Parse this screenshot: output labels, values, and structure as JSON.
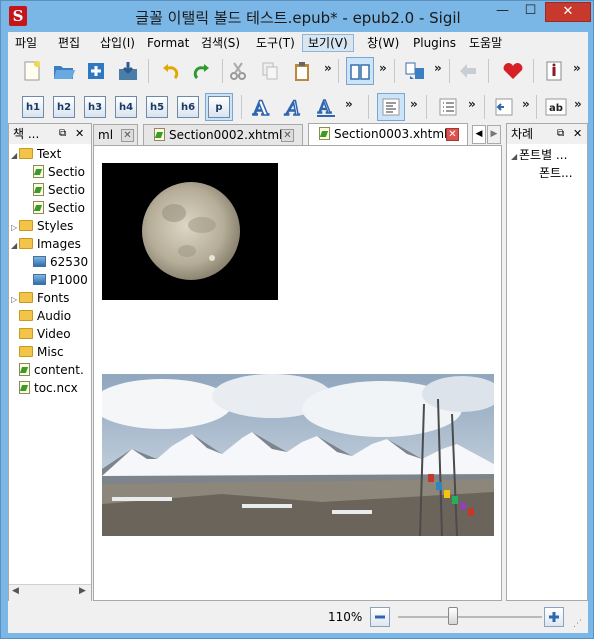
{
  "window": {
    "title": "글꼴 이탤릭 볼드 테스트.epub* - epub2.0 - Sigil",
    "app_icon_letter": "S",
    "minimize": "—",
    "maximize": "☐",
    "close": "✕"
  },
  "menu": [
    {
      "label": "파일"
    },
    {
      "label": "편집"
    },
    {
      "label": "삽입(I)"
    },
    {
      "label": "Format"
    },
    {
      "label": "검색(S)"
    },
    {
      "label": "도구(T)"
    },
    {
      "label": "보기(V)"
    },
    {
      "label": "창(W)"
    },
    {
      "label": "Plugins"
    },
    {
      "label": "도움말"
    }
  ],
  "toolbar2": {
    "headings": [
      "h1",
      "h2",
      "h3",
      "h4",
      "h5",
      "h6",
      "p"
    ],
    "italic_a": "A"
  },
  "book_browser": {
    "title": "책 ...",
    "items": [
      {
        "label": "Text",
        "type": "folder",
        "expanded": true
      },
      {
        "label": "Sectio",
        "type": "doc"
      },
      {
        "label": "Sectio",
        "type": "doc"
      },
      {
        "label": "Sectio",
        "type": "doc"
      },
      {
        "label": "Styles",
        "type": "folder"
      },
      {
        "label": "Images",
        "type": "folder",
        "expanded": true
      },
      {
        "label": "62530",
        "type": "image"
      },
      {
        "label": "P1000",
        "type": "image"
      },
      {
        "label": "Fonts",
        "type": "folder"
      },
      {
        "label": "Audio",
        "type": "folder"
      },
      {
        "label": "Video",
        "type": "folder"
      },
      {
        "label": "Misc",
        "type": "folder"
      },
      {
        "label": "content.",
        "type": "doc"
      },
      {
        "label": "toc.ncx",
        "type": "doc"
      }
    ]
  },
  "tabs": [
    {
      "label": "ml",
      "active": false
    },
    {
      "label": "Section0002.xhtml",
      "active": false
    },
    {
      "label": "Section0003.xhtml",
      "active": true
    }
  ],
  "toc_panel": {
    "title": "차례",
    "items": [
      {
        "label": "폰트별 ..."
      },
      {
        "label": "폰트..."
      }
    ]
  },
  "status": {
    "zoom": "110%",
    "zoom_level": 0.38
  }
}
